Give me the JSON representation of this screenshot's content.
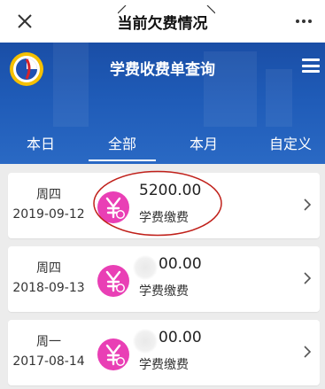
{
  "topbar": {
    "title": "当前欠费情况",
    "close_icon": "close-icon",
    "more_icon": "more-icon"
  },
  "header": {
    "title": "学费收费单查询",
    "logo_icon": "school-logo-icon",
    "menu_icon": "menu-icon",
    "colors": {
      "primary": "#1f5bb7",
      "accent_pink": "#e93fb5",
      "annotation_red": "#c0201a"
    }
  },
  "tabs": [
    {
      "label": "本日"
    },
    {
      "label": "全部",
      "active": true
    },
    {
      "label": "本月"
    },
    {
      "label": "自定义"
    }
  ],
  "records": [
    {
      "weekday": "周四",
      "date": "2019-09-12",
      "amount": "5200.00",
      "type": "学费缴费",
      "icon": "yen-coin-icon"
    },
    {
      "weekday": "周四",
      "date": "2018-09-13",
      "amount": "00.00",
      "type": "学费缴费",
      "icon": "yen-coin-icon"
    },
    {
      "weekday": "周一",
      "date": "2017-08-14",
      "amount": "00.00",
      "type": "学费缴费",
      "icon": "yen-coin-icon"
    }
  ]
}
